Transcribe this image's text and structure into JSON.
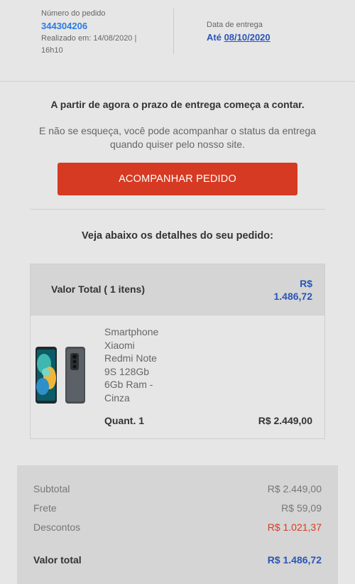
{
  "order": {
    "number_label": "Número do pedido",
    "number": "344304206",
    "placed_line1": "Realizado em: 14/08/2020 |",
    "placed_line2": "16h10",
    "delivery_label": "Data de entrega",
    "delivery_prefix": "Até",
    "delivery_date": "08/10/2020"
  },
  "message": {
    "headline": "A partir de agora o prazo de entrega começa a contar.",
    "sub_line1": "E não se esqueça, você pode acompanhar o status da entrega",
    "sub_line2": "quando quiser pelo nosso site."
  },
  "cta": {
    "label": "ACOMPANHAR PEDIDO",
    "color": "#d63a22"
  },
  "details_title": "Veja abaixo os detalhes do seu pedido:",
  "order_box": {
    "total_label": "Valor Total ( 1 itens)",
    "total_currency": "R$",
    "total_amount": "1.486,72",
    "product": {
      "name_lines": [
        "Smartphone",
        "Xiaomi",
        "Redmi Note",
        "9S 128Gb",
        "6Gb Ram -",
        "Cinza"
      ],
      "quantity": "Quant. 1",
      "price": "R$ 2.449,00",
      "image": "phone-image"
    }
  },
  "summary": {
    "subtotal_label": "Subtotal",
    "subtotal_value": "R$ 2.449,00",
    "frete_label": "Frete",
    "frete_value": "R$ 59,09",
    "descontos_label": "Descontos",
    "descontos_value": "R$ 1.021,37",
    "total_label": "Valor total",
    "total_value": "R$ 1.486,72"
  },
  "colors": {
    "accent_blue": "#2a55b8",
    "link_blue": "#2a7be4",
    "discount_red": "#d63a22",
    "background": "#e6e6e6"
  }
}
